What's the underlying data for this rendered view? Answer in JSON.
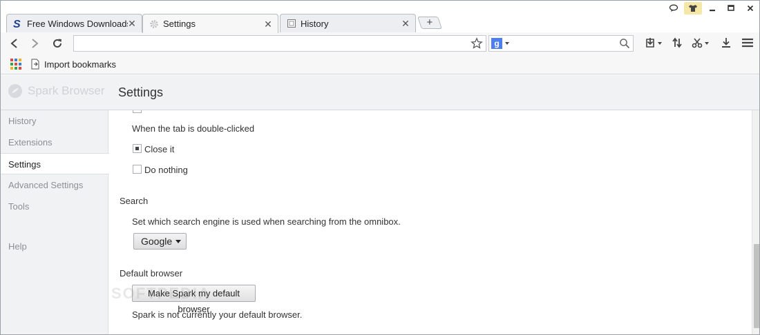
{
  "tabs": [
    {
      "title": "Free Windows Downloads",
      "icon": "softpedia-s-icon"
    },
    {
      "title": "Settings",
      "icon": "gear-icon",
      "active": true
    },
    {
      "title": "History",
      "icon": "history-page-icon"
    }
  ],
  "new_tab_symbol": "+",
  "address_bar": {
    "value": "",
    "placeholder": ""
  },
  "search_box": {
    "engine_icon_letter": "g",
    "value": ""
  },
  "bookmarks_bar": {
    "items": [
      {
        "label": "Import bookmarks",
        "icon": "import-icon"
      }
    ]
  },
  "header": {
    "logo_text": "Spark Browser",
    "page_title": "Settings"
  },
  "sidebar": {
    "items": [
      {
        "label": "History"
      },
      {
        "label": "Extensions"
      },
      {
        "label": "Settings",
        "active": true
      },
      {
        "label": "Advanced Settings"
      },
      {
        "label": "Tools"
      },
      {
        "label": "Help"
      }
    ]
  },
  "content": {
    "tab_double_click_label": "When the tab is double-clicked",
    "options": [
      {
        "label": "Close it",
        "checked": true
      },
      {
        "label": "Do nothing",
        "checked": false
      }
    ],
    "search": {
      "heading": "Search",
      "description": "Set which search engine is used when searching from the omnibox.",
      "engine": "Google"
    },
    "default_browser": {
      "heading": "Default browser",
      "button_label": "Make Spark my default browser",
      "status": "Spark is not currently your default browser."
    }
  },
  "watermark": "SOFTPEDIA",
  "colors": {
    "google_blue": "#4d7ff0",
    "active_tab_bg": "#f7f7f7",
    "sidebar_bg": "#f1f2f4"
  }
}
